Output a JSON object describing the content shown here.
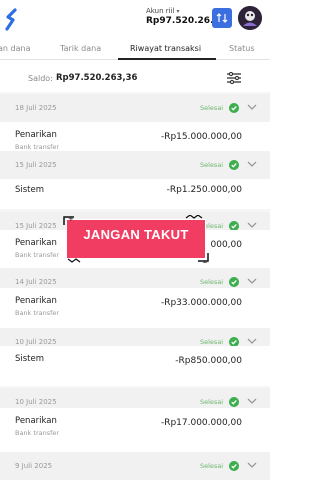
{
  "header": {
    "account_label": "Akun riil",
    "balance": "Rp97.520.26..."
  },
  "tabs": [
    {
      "label": "an dana"
    },
    {
      "label": "Tarik dana"
    },
    {
      "label": "Riwayat transaksi"
    },
    {
      "label": "Status"
    }
  ],
  "saldo": {
    "label": "Saldo:",
    "value": "Rp97.520.263,36"
  },
  "transactions": [
    {
      "date": "18 Juli 2025",
      "status": "Selesai",
      "title": "Penarikan",
      "subtitle": "Bank transfer",
      "amount": "-Rp15.000.000,00"
    },
    {
      "date": "15 Juli 2025",
      "status": "Selesai",
      "title": "Sistem",
      "subtitle": "",
      "amount": "-Rp1.250.000,00"
    },
    {
      "date": "15 Juli 2025",
      "status": "Selesai",
      "title": "Penarikan",
      "subtitle": "Bank transfer",
      "amount": "000,00"
    },
    {
      "date": "14 Juli 2025",
      "status": "Selesai",
      "title": "Penarikan",
      "subtitle": "Bank transfer",
      "amount": "-Rp33.000.000,00"
    },
    {
      "date": "10 Juli 2025",
      "status": "Selesai",
      "title": "Sistem",
      "subtitle": "",
      "amount": "-Rp850.000,00"
    },
    {
      "date": "10 Juli 2025",
      "status": "Selesai",
      "title": "Penarikan",
      "subtitle": "Bank transfer",
      "amount": "-Rp17.000.000,00"
    },
    {
      "date": "9 Juli 2025",
      "status": "Selesai",
      "title": "",
      "subtitle": "",
      "amount": ""
    }
  ],
  "overlay": {
    "text": "JANGAN TAKUT"
  },
  "icons": {
    "logo": "brand-logo-icon",
    "exchange": "exchange-icon",
    "filter": "filter-icon",
    "check": "check-icon",
    "chevron": "chevron-down-icon"
  }
}
